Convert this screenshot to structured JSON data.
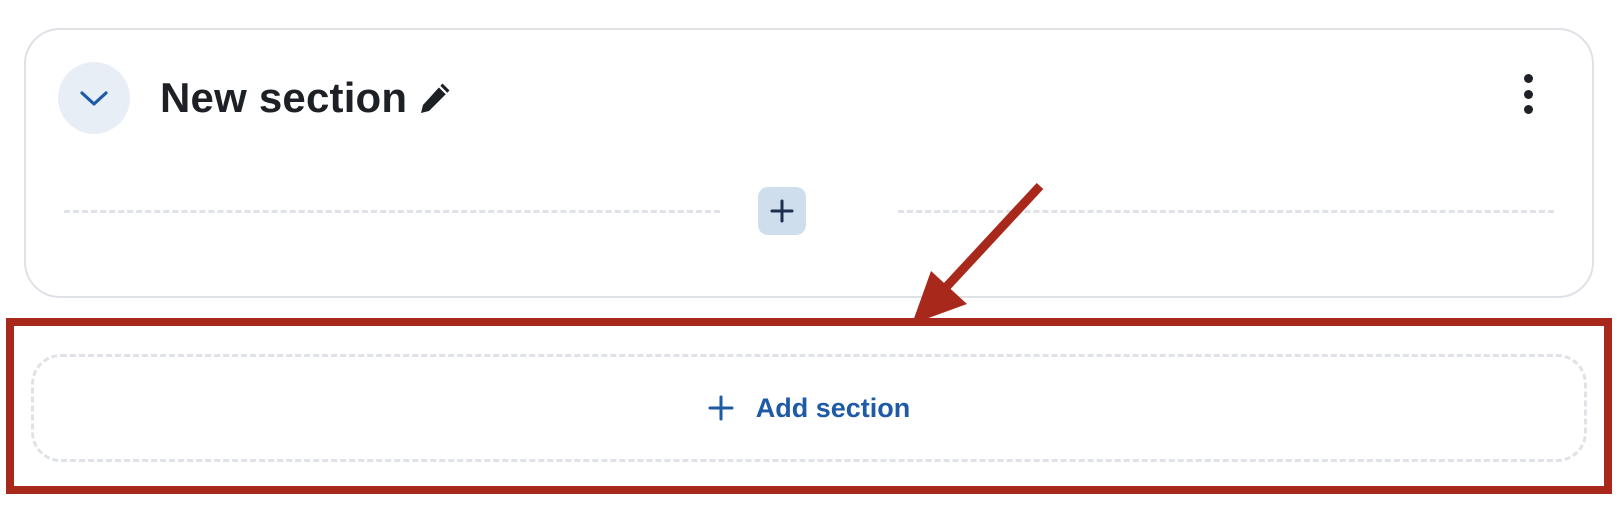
{
  "section": {
    "title": "New section",
    "icons": {
      "collapse": "chevron-down-icon",
      "edit": "pencil-icon",
      "menu": "kebab-menu-icon",
      "add_activity": "plus-icon"
    }
  },
  "add_section": {
    "label": "Add section",
    "icon": "plus-icon"
  },
  "colors": {
    "primary": "#1e5aa6",
    "title_text": "#1d2125",
    "collapse_bg": "#e7eef6",
    "add_activity_bg": "#cfdeed",
    "border": "#dee2e6",
    "dashed": "#dfe2e6",
    "annotation": "#a8291b"
  }
}
